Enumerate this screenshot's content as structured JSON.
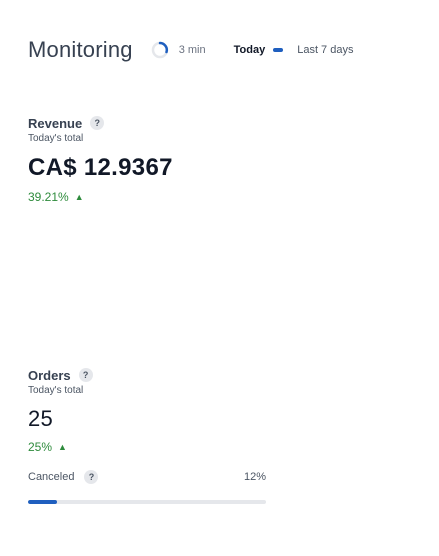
{
  "header": {
    "title": "Monitoring",
    "refresh_interval": "3 min",
    "range_today": "Today",
    "range_last7": "Last 7 days"
  },
  "revenue": {
    "label": "Revenue",
    "help": "?",
    "subtitle": "Today's total",
    "value": "CA$ 12.9367",
    "change": "39.21%",
    "trend_icon": "▲"
  },
  "orders": {
    "label": "Orders",
    "help": "?",
    "subtitle": "Today's total",
    "value": "25",
    "change": "25%",
    "trend_icon": "▲",
    "canceled": {
      "label": "Canceled",
      "help": "?",
      "percent": "12%",
      "fraction": 0.12
    }
  },
  "colors": {
    "accent": "#1f5fbf",
    "positive": "#2e8b3c"
  }
}
